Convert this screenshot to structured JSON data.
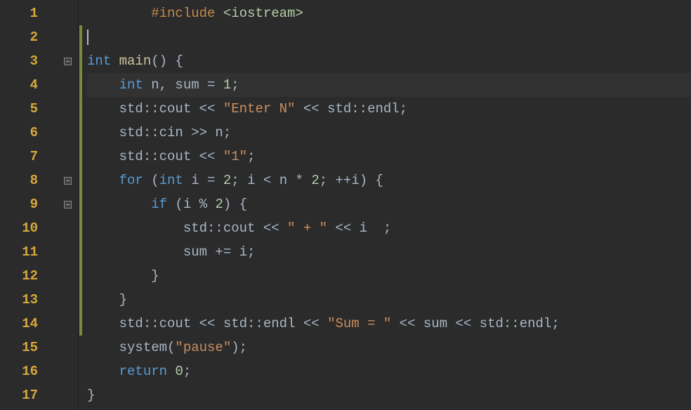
{
  "editor": {
    "lineNumbers": [
      "1",
      "2",
      "3",
      "4",
      "5",
      "6",
      "7",
      "8",
      "9",
      "10",
      "11",
      "12",
      "13",
      "14",
      "15",
      "16",
      "17"
    ],
    "foldMarkers": {
      "2": true,
      "7": true,
      "8": true
    },
    "changeBar": {
      "start": 1,
      "end": 14
    },
    "highlightedLine": 3,
    "cursorLine": 1,
    "lines": [
      [
        {
          "t": "        ",
          "c": "tok-punc"
        },
        {
          "t": "#include ",
          "c": "tok-pre"
        },
        {
          "t": "<iostream>",
          "c": "tok-incl"
        }
      ],
      [],
      [
        {
          "t": "int",
          "c": "tok-kw"
        },
        {
          "t": " ",
          "c": "tok-punc"
        },
        {
          "t": "main",
          "c": "tok-fn"
        },
        {
          "t": "() {",
          "c": "tok-punc"
        }
      ],
      [
        {
          "t": "    ",
          "c": "tok-punc"
        },
        {
          "t": "int",
          "c": "tok-kw"
        },
        {
          "t": " n, sum = ",
          "c": "tok-var"
        },
        {
          "t": "1",
          "c": "tok-num"
        },
        {
          "t": ";",
          "c": "tok-punc"
        }
      ],
      [
        {
          "t": "    std::cout << ",
          "c": "tok-var"
        },
        {
          "t": "\"Enter N\"",
          "c": "tok-str"
        },
        {
          "t": " << std::endl;",
          "c": "tok-var"
        }
      ],
      [
        {
          "t": "    std::cin >> n;",
          "c": "tok-var"
        }
      ],
      [
        {
          "t": "    std::cout << ",
          "c": "tok-var"
        },
        {
          "t": "\"1\"",
          "c": "tok-str"
        },
        {
          "t": ";",
          "c": "tok-punc"
        }
      ],
      [
        {
          "t": "    ",
          "c": "tok-punc"
        },
        {
          "t": "for",
          "c": "tok-kw"
        },
        {
          "t": " (",
          "c": "tok-punc"
        },
        {
          "t": "int",
          "c": "tok-kw"
        },
        {
          "t": " i = ",
          "c": "tok-var"
        },
        {
          "t": "2",
          "c": "tok-num"
        },
        {
          "t": "; i < n * ",
          "c": "tok-var"
        },
        {
          "t": "2",
          "c": "tok-num"
        },
        {
          "t": "; ++i) {",
          "c": "tok-var"
        }
      ],
      [
        {
          "t": "        ",
          "c": "tok-punc"
        },
        {
          "t": "if",
          "c": "tok-kw"
        },
        {
          "t": " (i % ",
          "c": "tok-var"
        },
        {
          "t": "2",
          "c": "tok-num"
        },
        {
          "t": ") {",
          "c": "tok-var"
        }
      ],
      [
        {
          "t": "            std::cout << ",
          "c": "tok-var"
        },
        {
          "t": "\" + \"",
          "c": "tok-str"
        },
        {
          "t": " << i  ;",
          "c": "tok-var"
        }
      ],
      [
        {
          "t": "            sum += i;",
          "c": "tok-var"
        }
      ],
      [
        {
          "t": "        }",
          "c": "tok-punc"
        }
      ],
      [
        {
          "t": "    }",
          "c": "tok-punc"
        }
      ],
      [
        {
          "t": "    std::cout << std::endl << ",
          "c": "tok-var"
        },
        {
          "t": "\"Sum = \"",
          "c": "tok-str"
        },
        {
          "t": " << sum << std::endl;",
          "c": "tok-var"
        }
      ],
      [
        {
          "t": "    system(",
          "c": "tok-var"
        },
        {
          "t": "\"pause\"",
          "c": "tok-str"
        },
        {
          "t": ");",
          "c": "tok-punc"
        }
      ],
      [
        {
          "t": "    ",
          "c": "tok-punc"
        },
        {
          "t": "return",
          "c": "tok-kw"
        },
        {
          "t": " ",
          "c": "tok-punc"
        },
        {
          "t": "0",
          "c": "tok-num"
        },
        {
          "t": ";",
          "c": "tok-punc"
        }
      ],
      [
        {
          "t": "}",
          "c": "tok-punc"
        }
      ]
    ]
  }
}
